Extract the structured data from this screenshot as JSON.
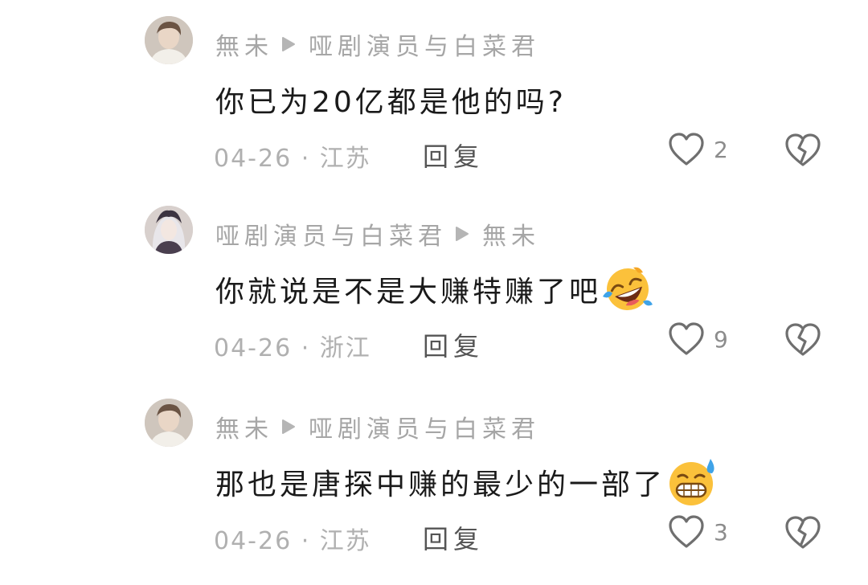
{
  "comments": [
    {
      "author": "無未",
      "reply_to": "哑剧演员与白菜君",
      "text": "你已为20亿都是他的吗?",
      "emoji": "",
      "date": "04-26",
      "location": "江苏",
      "reply_label": "回复",
      "likes": "2",
      "avatar": "male-portrait"
    },
    {
      "author": "哑剧演员与白菜君",
      "reply_to": "無未",
      "text": "你就说是不是大赚特赚了吧",
      "emoji": "rolling-laughing-emoji",
      "date": "04-26",
      "location": "浙江",
      "reply_label": "回复",
      "likes": "9",
      "avatar": "anime-portrait"
    },
    {
      "author": "無未",
      "reply_to": "哑剧演员与白菜君",
      "text": "那也是唐探中赚的最少的一部了",
      "emoji": "grinning-sweat-emoji",
      "date": "04-26",
      "location": "江苏",
      "reply_label": "回复",
      "likes": "3",
      "avatar": "male-portrait"
    }
  ],
  "separator": " · ",
  "icons": {
    "reply_arrow": "play-arrow-icon",
    "like": "heart-outline-icon",
    "dislike": "broken-heart-icon"
  },
  "colors": {
    "name_gray": "#a6a6a6",
    "text_dark": "#1a1a1a",
    "meta_gray": "#b0b0b0"
  }
}
